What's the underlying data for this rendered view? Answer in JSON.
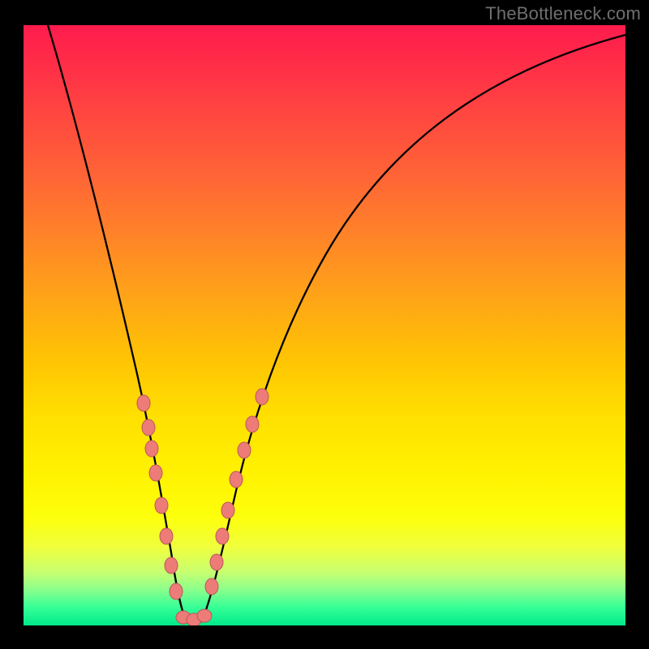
{
  "watermark": "TheBottleneck.com",
  "chart_data": {
    "type": "line",
    "title": "",
    "xlabel": "",
    "ylabel": "",
    "xlim": [
      0,
      100
    ],
    "ylim": [
      0,
      100
    ],
    "optimum_x": 27,
    "curve": {
      "description": "V-shaped bottleneck curve; y-value represents bottleneck severity (0 = optimal, 100 = worst). Minimum near x≈27.",
      "x": [
        3,
        6,
        9,
        12,
        15,
        18,
        20,
        22,
        24,
        25,
        26,
        27,
        28,
        29,
        30,
        32,
        34,
        36,
        40,
        45,
        50,
        55,
        60,
        65,
        70,
        75,
        80,
        85,
        90,
        95,
        100
      ],
      "y": [
        100,
        88,
        76,
        63,
        50,
        38,
        29,
        20,
        10,
        5,
        2,
        0.5,
        0.5,
        2,
        5,
        11,
        18,
        24,
        36,
        47,
        56,
        63,
        69,
        74,
        78,
        81,
        84,
        86,
        88,
        89.5,
        90.5
      ]
    },
    "sparse_markers": {
      "description": "Salmon-colored point markers shown only in the lower ~30% of the curve (both arms near the minimum).",
      "left_arm_x": [
        18,
        19.5,
        21,
        22,
        23,
        24,
        25,
        25.5
      ],
      "right_arm_x": [
        28.5,
        29.5,
        30.5,
        31.5,
        33,
        34.5,
        36,
        37.5
      ],
      "bottom_x": [
        26,
        27,
        28
      ]
    },
    "background_gradient": {
      "top_color": "#ff1b4d",
      "mid_color": "#ffdf00",
      "bottom_color": "#00ea8b"
    }
  }
}
